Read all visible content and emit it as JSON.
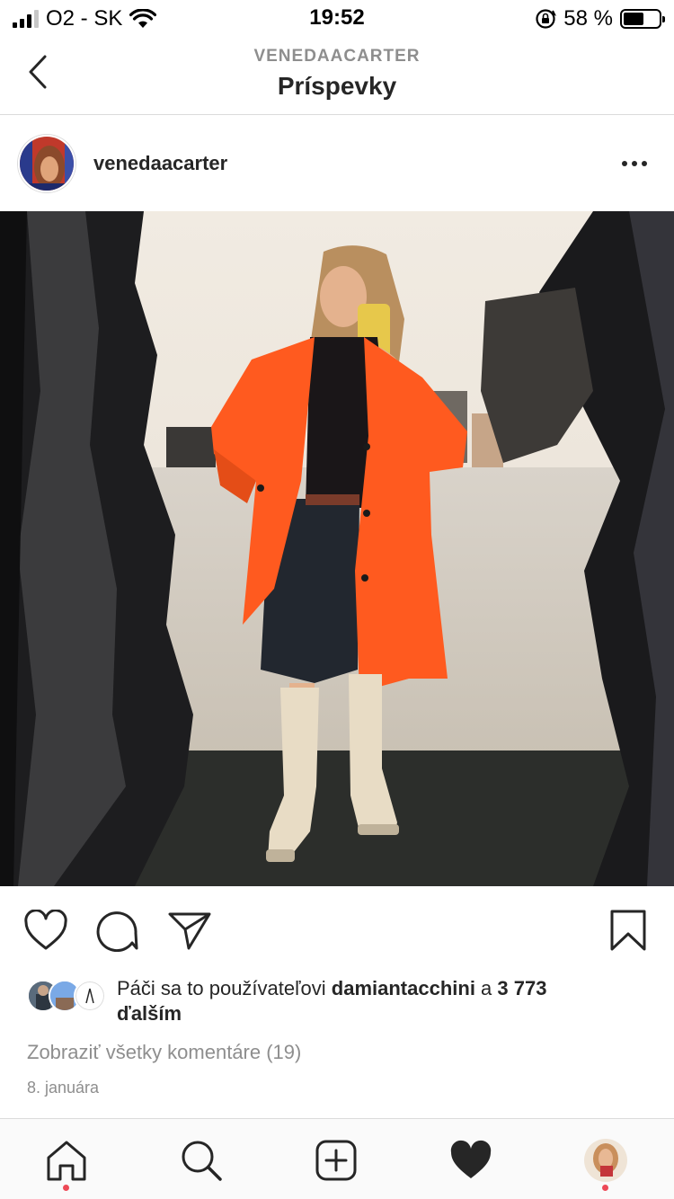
{
  "status_bar": {
    "carrier": "O2 - SK",
    "time": "19:52",
    "battery_text": "58 %",
    "battery_level": 0.58
  },
  "nav": {
    "username": "VENEDAACARTER",
    "title": "Príspevky"
  },
  "post": {
    "username": "venedaacarter"
  },
  "likes": {
    "prefix": "Páči sa to používateľovi ",
    "user": "damiantacchini",
    "connector": " a ",
    "count": "3 773",
    "suffix": "ďalším"
  },
  "comments": {
    "view_all": "Zobraziť všetky komentáre (19)"
  },
  "date": "8. januára",
  "icons": {
    "back": "chevron-left-icon",
    "more": "more-horizontal-icon",
    "like": "heart-outline-icon",
    "comment": "comment-bubble-icon",
    "share": "paper-plane-icon",
    "save": "bookmark-icon",
    "home": "home-icon",
    "search": "search-icon",
    "new_post": "add-post-icon",
    "activity": "heart-filled-icon",
    "profile": "profile-avatar-icon"
  },
  "colors": {
    "notification_dot": "#ed4956",
    "coat": "#ff5a1f",
    "secondary_text": "#8e8e8e"
  }
}
